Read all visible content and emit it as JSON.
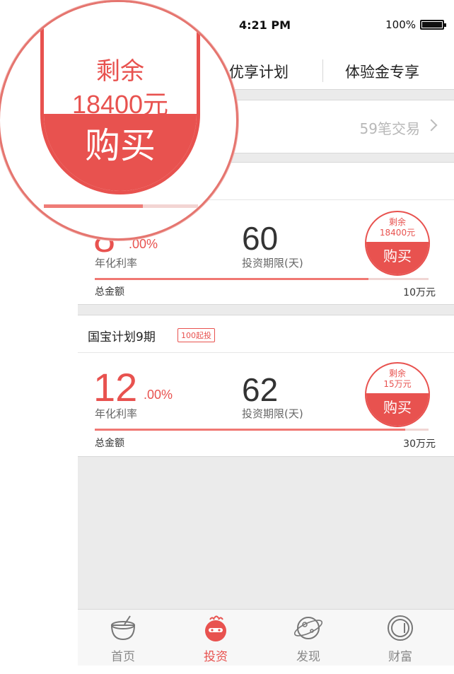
{
  "status_bar": {
    "time": "4:21 PM",
    "battery": "100%"
  },
  "tabs": [
    {
      "label": "优享计划"
    },
    {
      "label": "体验金专享"
    }
  ],
  "transactions": {
    "label": "59笔交易"
  },
  "products": [
    {
      "name": "",
      "rate_int": "8",
      "rate_dec": ".00%",
      "rate_label": "年化利率",
      "days": "60",
      "days_label": "投资期限(天)",
      "remain_label": "剩余",
      "remain_amount": "18400元",
      "buy_label": "购买",
      "progress": 0.82,
      "total_label": "总金额",
      "total_value": "10万元"
    },
    {
      "name": "国宝计划9期",
      "tag": "100起投",
      "rate_int": "12",
      "rate_dec": ".00%",
      "rate_label": "年化利率",
      "days": "62",
      "days_label": "投资期限(天)",
      "remain_label": "剩余",
      "remain_amount": "15万元",
      "buy_label": "购买",
      "progress": 0.93,
      "total_label": "总金额",
      "total_value": "30万元"
    }
  ],
  "nav": [
    {
      "label": "首页",
      "icon": "coconut-icon",
      "active": false
    },
    {
      "label": "投资",
      "icon": "invest-icon",
      "active": true
    },
    {
      "label": "发现",
      "icon": "planet-icon",
      "active": false
    },
    {
      "label": "财富",
      "icon": "coin-icon",
      "active": false
    }
  ],
  "magnifier": {
    "remain_label": "剩余",
    "remain_amount": "18400元",
    "buy_label": "购买",
    "progress": 0.64
  },
  "colors": {
    "accent": "#e8524f",
    "background": "#ebebeb"
  }
}
